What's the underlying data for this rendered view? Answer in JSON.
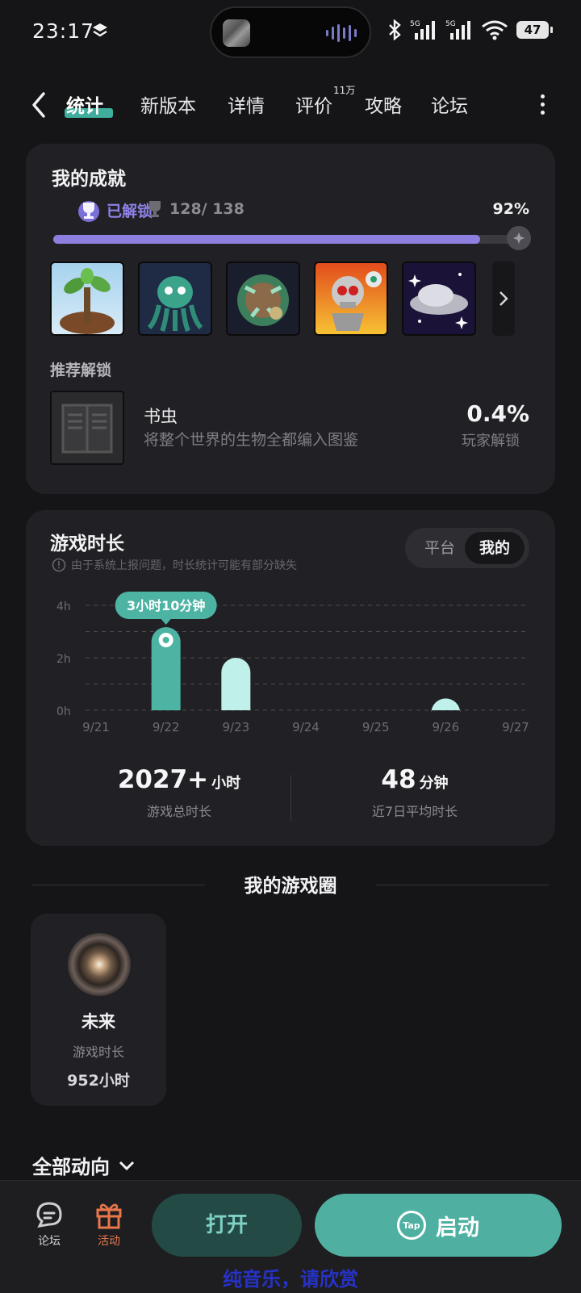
{
  "status_bar": {
    "time": "23:17",
    "network_1": "5G",
    "network_2": "5G",
    "battery": "47"
  },
  "tabs": [
    {
      "label": "统计"
    },
    {
      "label": "新版本"
    },
    {
      "label": "详情"
    },
    {
      "label": "评价",
      "badge": "11万"
    },
    {
      "label": "攻略"
    },
    {
      "label": "论坛"
    }
  ],
  "achievements": {
    "title": "我的成就",
    "unlocked_label": "已解锁",
    "count": "128/ 138",
    "percent": "92%",
    "progress": 0.92,
    "icons": [
      "sapling-achievement-icon",
      "cthulhu-achievement-icon",
      "plantera-bulb-achievement-icon",
      "skeletron-achievement-icon",
      "ufo-achievement-icon"
    ]
  },
  "recommend": {
    "title": "推荐解锁",
    "name": "书虫",
    "desc": "将整个世界的生物全都编入图鉴",
    "percent": "0.4%",
    "percent_label": "玩家解锁"
  },
  "playtime": {
    "title": "游戏时长",
    "notice": "由于系统上报问题，时长统计可能有部分缺失",
    "toggle": [
      "平台",
      "我的"
    ],
    "tooltip": "3小时10分钟",
    "total_value": "2027+",
    "total_unit": "小时",
    "total_label": "游戏总时长",
    "avg_value": "48",
    "avg_unit": "分钟",
    "avg_label": "近7日平均时长"
  },
  "chart_data": {
    "type": "bar",
    "categories": [
      "9/21",
      "9/22",
      "9/23",
      "9/24",
      "9/25",
      "9/26",
      "9/27"
    ],
    "values": [
      0,
      3.17,
      2.0,
      0,
      0,
      0.45,
      0
    ],
    "y_ticks": [
      "4h",
      "2h",
      "0h"
    ],
    "ylim": [
      0,
      4
    ],
    "highlight_index": 1,
    "colors": {
      "highlight": "#4db3a3",
      "bar": "#bff0e9",
      "grid": "#4a4a50",
      "tick": "#6c6c72"
    }
  },
  "circle": {
    "title": "我的游戏圈",
    "member": {
      "name": "未来",
      "label": "游戏时长",
      "hours": "952小时"
    }
  },
  "feed_filter": "全部动向",
  "bottom_bar": {
    "forum": "论坛",
    "activity": "活动",
    "open": "打开",
    "launch": "启动",
    "tap_logo": "Tap",
    "watermark": "纯音乐，请欣赏"
  },
  "colors": {
    "accent": "#4fb0a2",
    "purple": "#8c7fe0",
    "activity": "#e8774a"
  }
}
